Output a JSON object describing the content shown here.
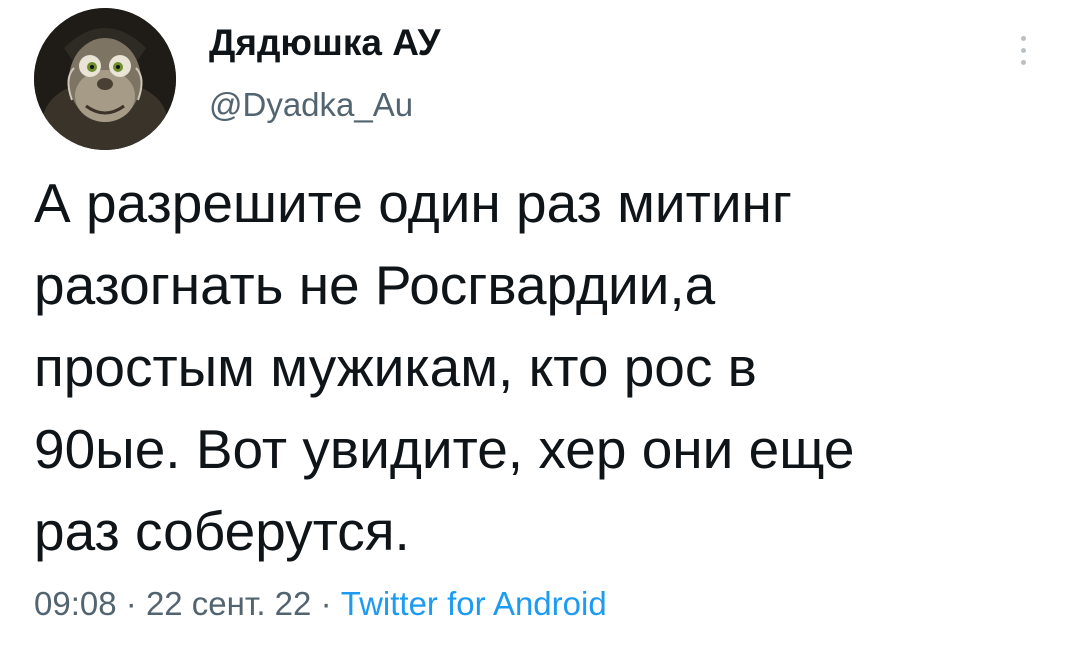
{
  "author": {
    "display_name": "Дядюшка АУ",
    "handle": "@Dyadka_Au"
  },
  "tweet": {
    "lines": [
      "А разрешите один раз митинг",
      "разогнать не Росгвардии,а",
      "простым мужикам, кто рос в",
      "90ые. Вот увидите, хер они еще",
      "раз соберутся."
    ]
  },
  "meta": {
    "time": "09:08",
    "separator": "·",
    "date": "22 сент. 22",
    "source": "Twitter for Android"
  },
  "icons": {
    "more": "more-vertical-icon"
  },
  "colors": {
    "text": "#0f1419",
    "secondary": "#536471",
    "link": "#1d9bf0"
  }
}
